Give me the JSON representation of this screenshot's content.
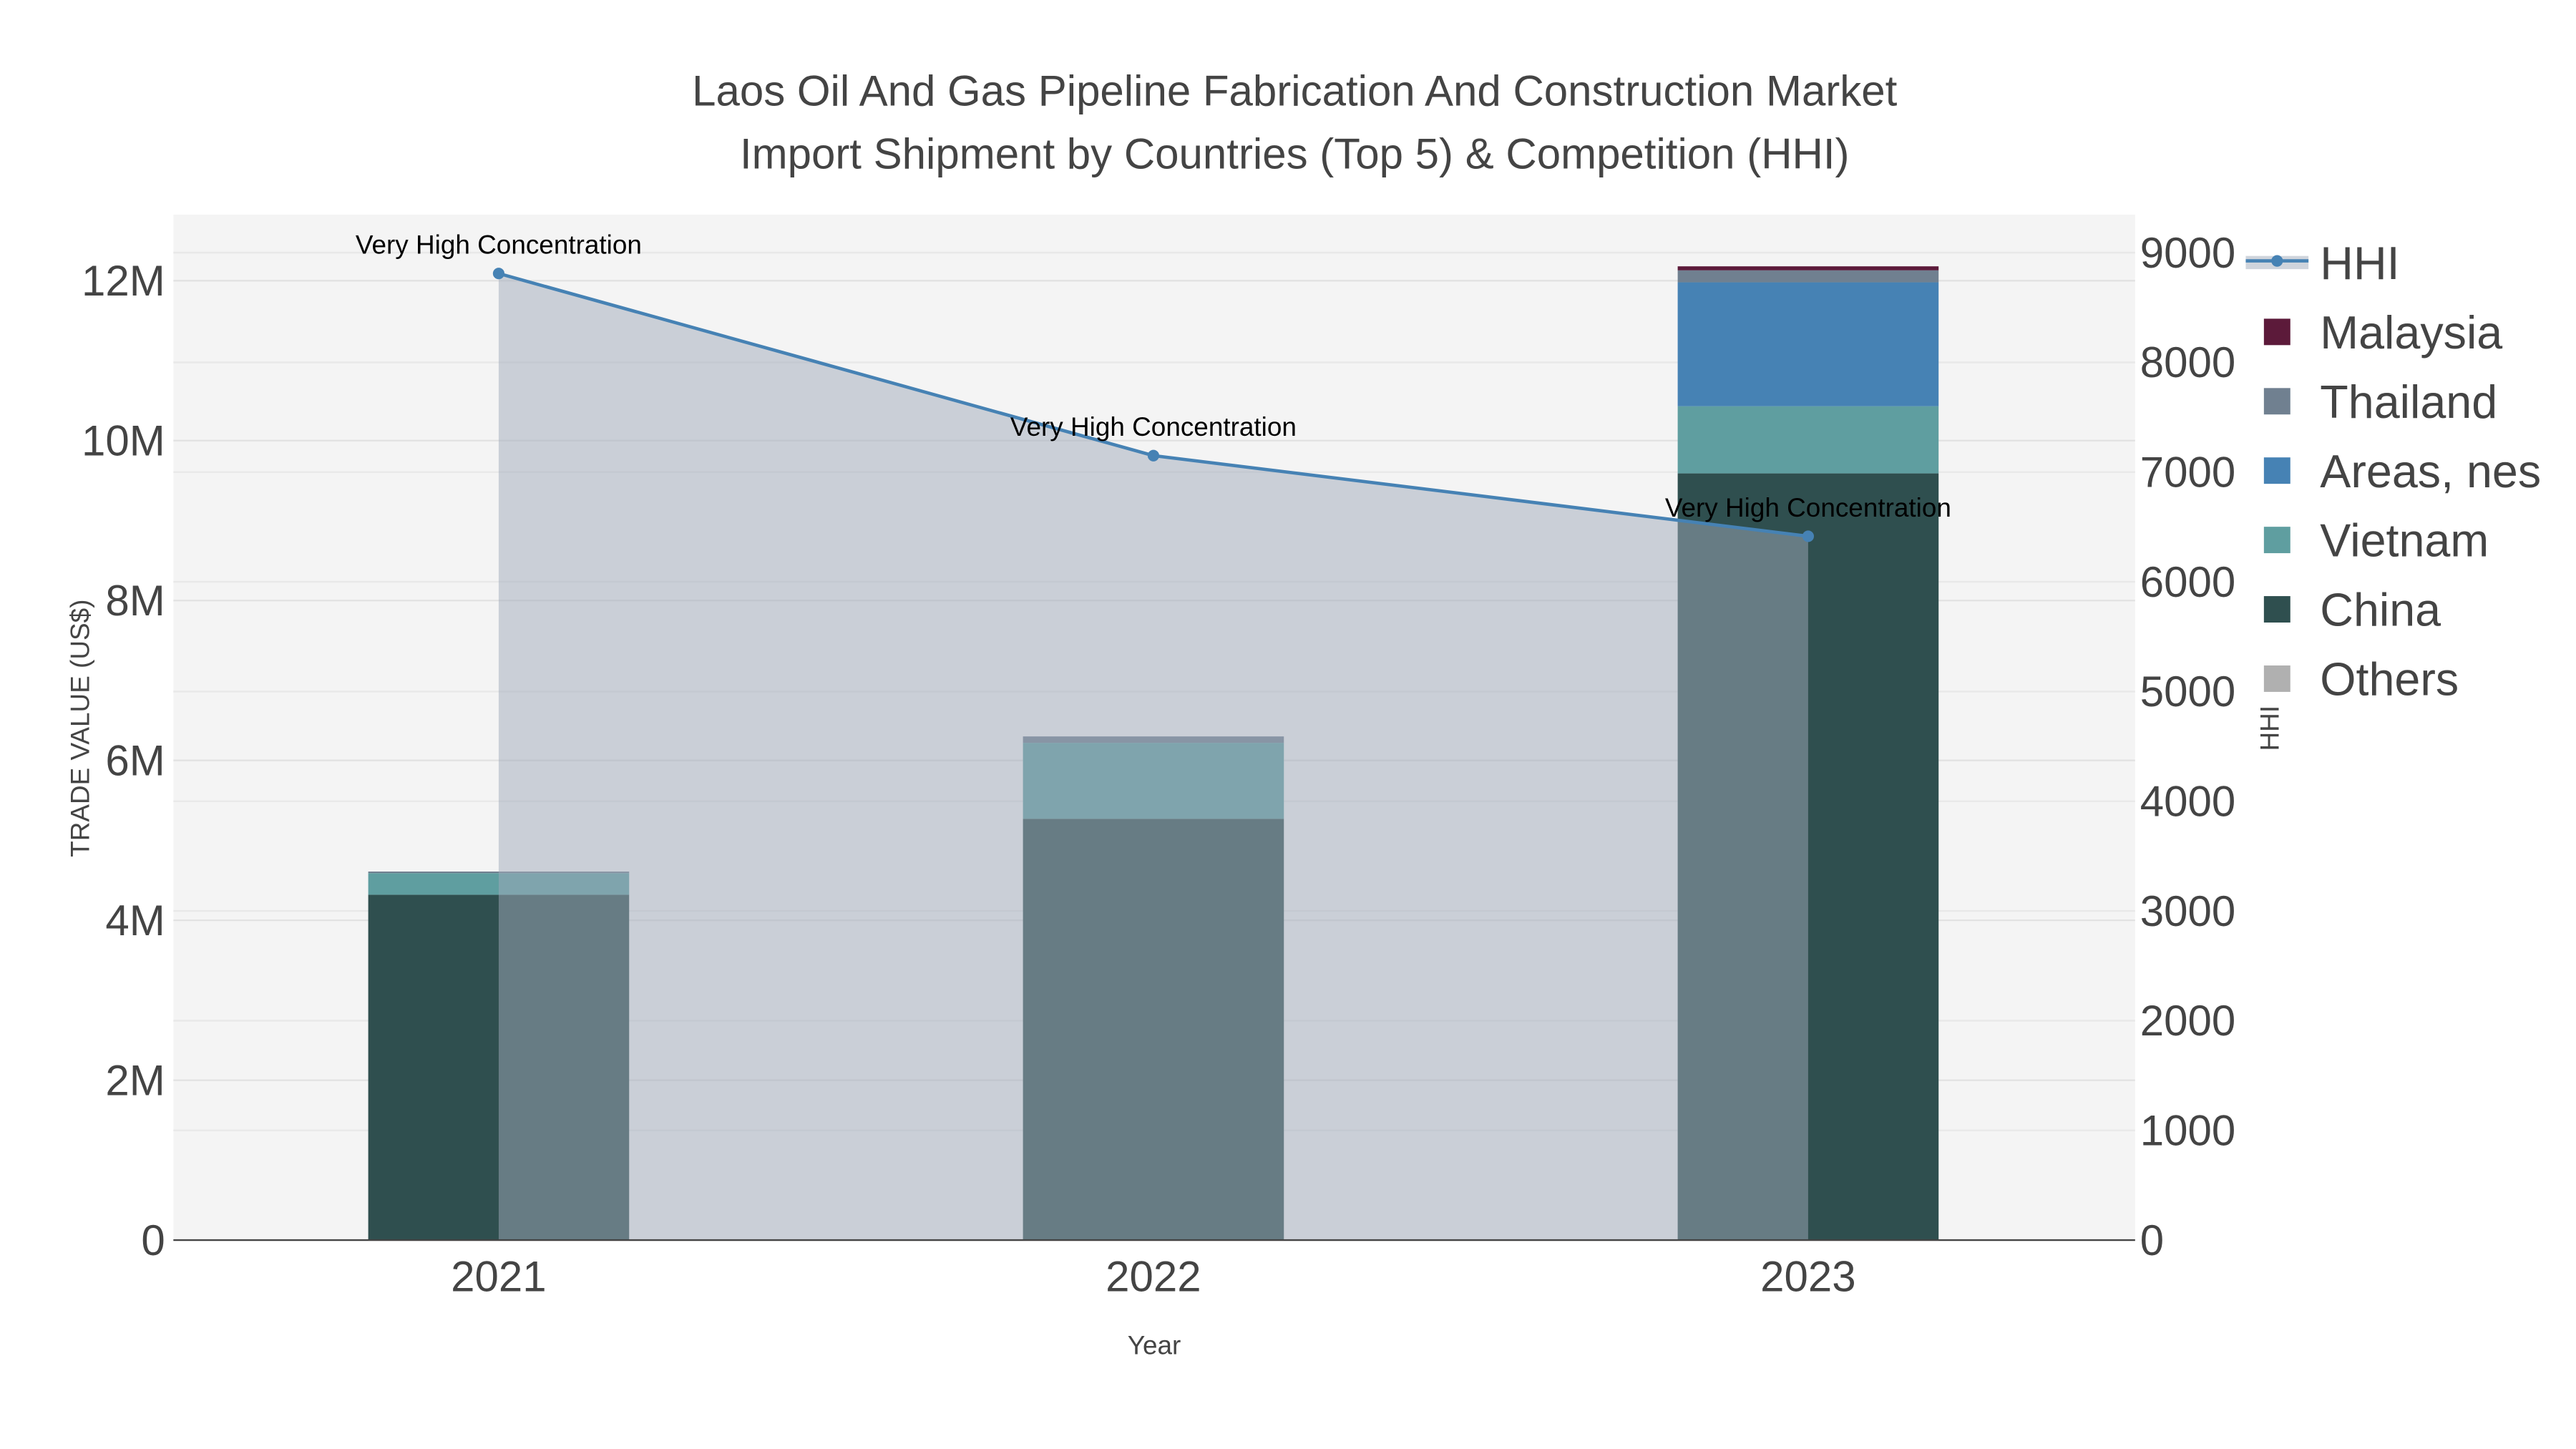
{
  "chart_data": {
    "type": "bar",
    "title_line1": "Laos Oil And Gas Pipeline Fabrication And Construction Market",
    "title_line2": "Import Shipment by Countries (Top 5) & Competition (HHI)",
    "xlabel": "Year",
    "ylabel": "TRADE VALUE (US$)",
    "y2label": "HHI",
    "categories": [
      "2021",
      "2022",
      "2023"
    ],
    "ylim": [
      0,
      12800000
    ],
    "y2lim": [
      0,
      9300
    ],
    "yticks": [
      {
        "v": 0,
        "label": "0"
      },
      {
        "v": 2000000,
        "label": "2M"
      },
      {
        "v": 4000000,
        "label": "4M"
      },
      {
        "v": 6000000,
        "label": "6M"
      },
      {
        "v": 8000000,
        "label": "8M"
      },
      {
        "v": 10000000,
        "label": "10M"
      },
      {
        "v": 12000000,
        "label": "12M"
      }
    ],
    "y2ticks": [
      {
        "v": 0,
        "label": "0"
      },
      {
        "v": 1000,
        "label": "1000"
      },
      {
        "v": 2000,
        "label": "2000"
      },
      {
        "v": 3000,
        "label": "3000"
      },
      {
        "v": 4000,
        "label": "4000"
      },
      {
        "v": 5000,
        "label": "5000"
      },
      {
        "v": 6000,
        "label": "6000"
      },
      {
        "v": 7000,
        "label": "7000"
      },
      {
        "v": 8000,
        "label": "8000"
      },
      {
        "v": 9000,
        "label": "9000"
      }
    ],
    "series": [
      {
        "name": "China",
        "color": "#2f4f4f",
        "values": [
          4320000,
          5270000,
          9590000
        ]
      },
      {
        "name": "Vietnam",
        "color": "#5f9ea0",
        "values": [
          270000,
          950000,
          840000
        ]
      },
      {
        "name": "Areas, nes",
        "color": "#4682b4",
        "values": [
          0,
          0,
          1550000
        ]
      },
      {
        "name": "Thailand",
        "color": "#708090",
        "values": [
          20000,
          80000,
          150000
        ]
      },
      {
        "name": "Malaysia",
        "color": "#5c1a3a",
        "values": [
          0,
          0,
          50000
        ]
      },
      {
        "name": "Others",
        "color": "#b0b0b0",
        "values": [
          0,
          0,
          0
        ]
      }
    ],
    "hhi": {
      "name": "HHI",
      "color": "#4682b4",
      "values": [
        8810,
        7150,
        6415
      ],
      "annotations": [
        "Very High Concentration",
        "Very High Concentration",
        "Very High Concentration"
      ]
    },
    "legend": [
      "HHI",
      "Malaysia",
      "Thailand",
      "Areas, nes",
      "Vietnam",
      "China",
      "Others"
    ],
    "legend_position": "right"
  }
}
